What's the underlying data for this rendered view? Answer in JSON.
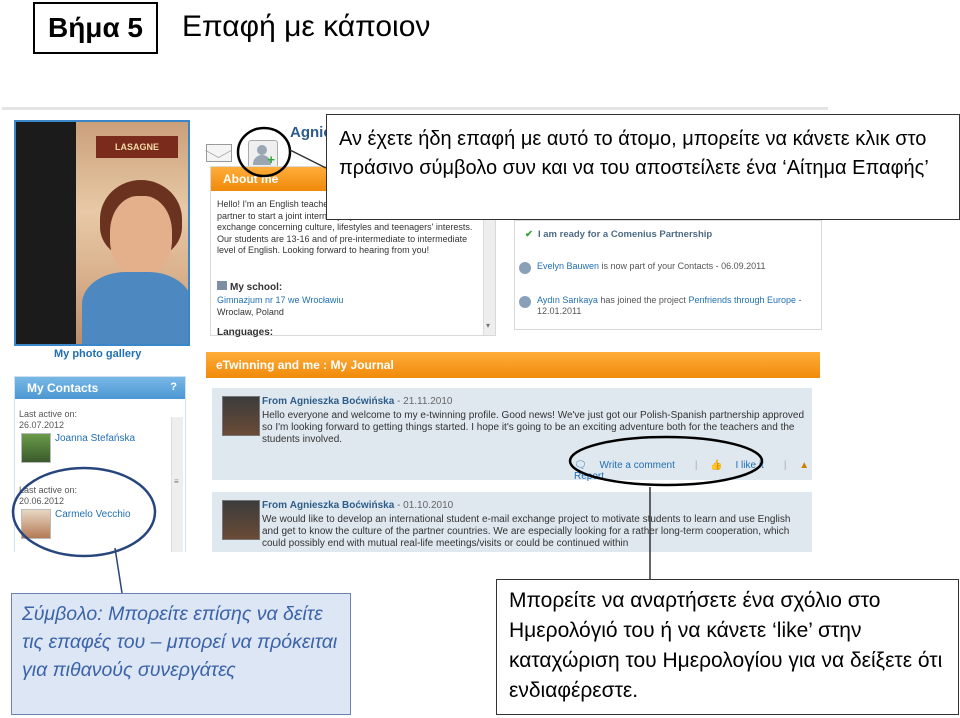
{
  "header": {
    "step_label": "Βήμα 5",
    "title": "Επαφή με κάποιον"
  },
  "profile": {
    "name_partial": "Agnie",
    "photo_sign": "LASAGNE",
    "gallery_link": "My photo gallery"
  },
  "about": {
    "heading": "About me",
    "text": "Hello! I'm an English teacher ... Wroclaw, Poland. We are ... for partner to start a joint internet project based on students' e-mail exchange concerning culture, lifestyles and teenagers' interests. Our students are 13-16 and of pre-intermediate to intermediate level of English. Looking forward to hearing from you!",
    "school_label": "My school:",
    "school_name": "Gimnazjum nr 17 we Wrocławiu",
    "school_location": "Wroclaw, Poland",
    "languages_label": "Languages:"
  },
  "status": {
    "ready_items": [
      "I am ready for a Comenius Partnership"
    ],
    "activities": [
      {
        "user": "Evelyn Bauwen",
        "text": " is now part of your Contacts - ",
        "date": "06.09.2011"
      },
      {
        "user": "Aydın Sarıkaya",
        "text": " has joined the project ",
        "project": "Penfriends through Europe",
        "date": " - 12.01.2011"
      }
    ]
  },
  "contacts": {
    "heading": "My Contacts",
    "help": "?",
    "items": [
      {
        "last_active_label": "Last active on:",
        "date": "26.07.2012",
        "name": "Joanna Stefańska"
      },
      {
        "last_active_label": "Last active on:",
        "date": "20.06.2012",
        "name": "Carmelo Vecchio"
      }
    ]
  },
  "journal": {
    "heading": "eTwinning and me : My Journal",
    "entries": [
      {
        "from_label": "From",
        "author": "Agnieszka Boćwińska",
        "date": " - 21.11.2010",
        "text": "Hello everyone and welcome to my e-twinning profile. Good news! We've just got our Polish-Spanish partnership approved so I'm looking forward to getting things started. I hope it's going to be an exciting adventure both for the teachers and the students involved.",
        "write_comment": "Write a comment",
        "like": "I like it",
        "report": "Report"
      },
      {
        "from_label": "From",
        "author": "Agnieszka Boćwińska",
        "date": " - 01.10.2010",
        "text": "We would like to develop an international student e-mail exchange project to motivate students to learn and use English and get to know the culture of the partner countries. We are especially looking for a rather long-term cooperation, which could possibly end with mutual real-life meetings/visits or could be continued within"
      }
    ]
  },
  "callouts": {
    "top": "Αν έχετε ήδη επαφή με αυτό το άτομο, μπορείτε να κάνετε κλικ στο πράσινο σύμβολο συν και να του αποστείλετε ένα ‘Αίτημα Επαφής’",
    "left": "Σύμβολο: Μπορείτε επίσης να δείτε τις επαφές του – μπορεί να πρόκειται για πιθανούς συνεργάτες",
    "right": "Μπορείτε να αναρτήσετε ένα σχόλιο στο Ημερολόγιό του ή να κάνετε ‘like’ στην καταχώριση του Ημερολογίου για να δείξετε ότι ενδιαφέρεστε."
  },
  "colors": {
    "orange": "#f08a0a",
    "blue": "#1f6fb5",
    "callout_blue": "#3b63a8"
  }
}
